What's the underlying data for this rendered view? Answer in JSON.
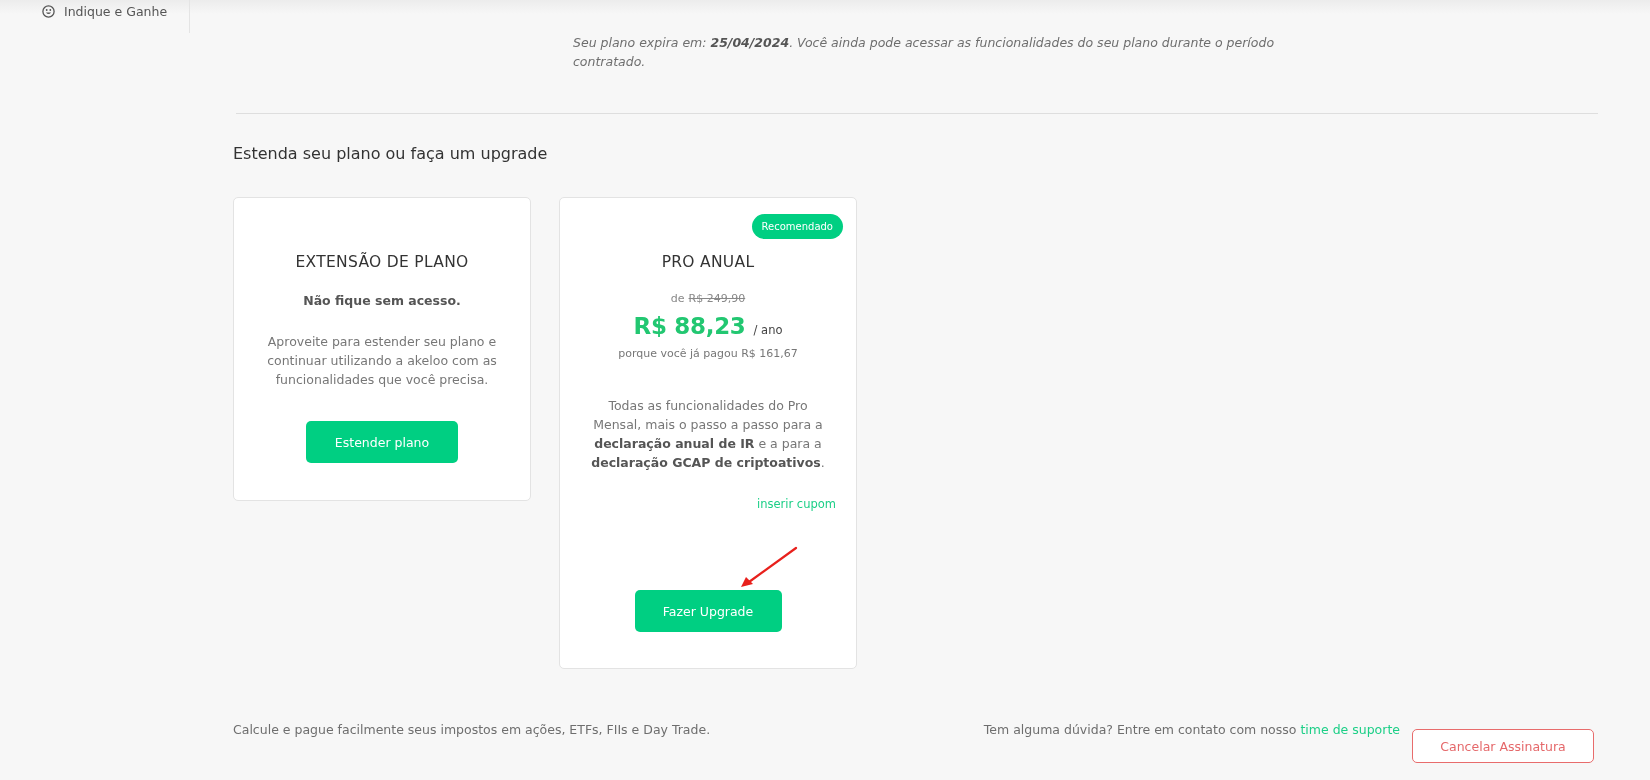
{
  "sidebar": {
    "items": [
      {
        "label": "Indique e Ganhe"
      }
    ]
  },
  "plan_status": {
    "text": "Seu plano expira em: **25/04/2024**. Você ainda pode acessar as funcionalidades do seu plano durante o período contratado."
  },
  "upgrade_section": {
    "title": "Estenda seu plano ou faça um upgrade",
    "cards": [
      {
        "kind": "plain",
        "title": "EXTENSÃO DE PLANO",
        "subtitle": "Não fique sem acesso.",
        "description": "Aproveite para estender seu plano e continuar utilizando a akeloo com as funcionalidades que você precisa.",
        "button": "Estender plano"
      },
      {
        "kind": "offer",
        "badge": "Recomendado",
        "title": "PRO ANUAL",
        "old_price_prefix": "de",
        "old_price": "R$ 249,90",
        "price": "R$ 88,23",
        "period": "/ ano",
        "price_note": "porque você já pagou R$ 161,67",
        "description": "Todas as funcionalidades do Pro Mensal, mais o passo a passo para a **declaração anual de IR** e a para a **declaração GCAP de criptoativos**.",
        "coupon_link": "inserir cupom",
        "button": "Fazer Upgrade",
        "pointer_arrow": true
      }
    ]
  },
  "footer": {
    "tagline": "Calcule e pague facilmente seus impostos em ações, ETFs, FIIs e Day Trade.",
    "support_text": "Tem alguma dúvida? Entre em contato com nosso",
    "support_link": "time de suporte",
    "cancel_button": "Cancelar Assinatura"
  }
}
